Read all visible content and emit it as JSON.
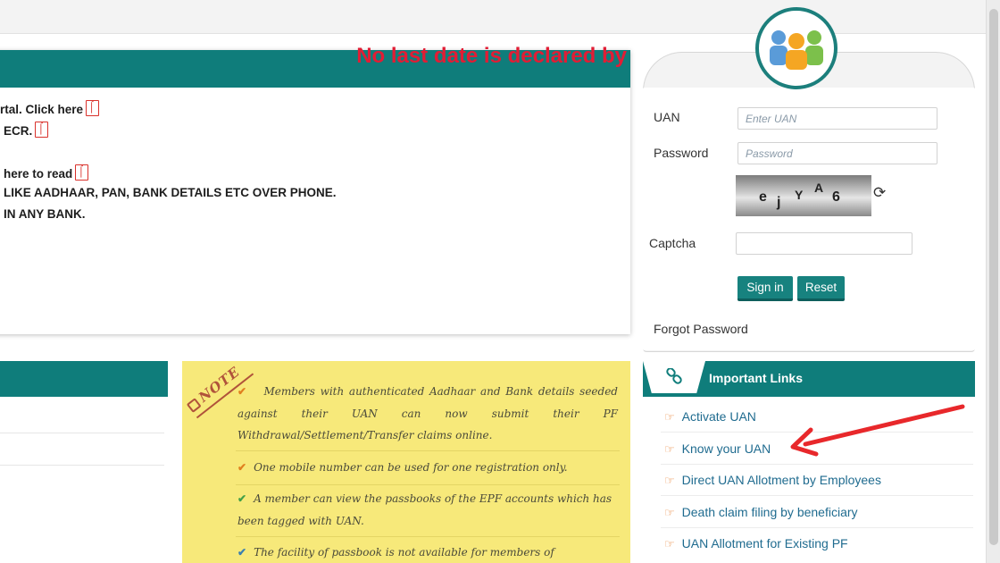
{
  "colors": {
    "teal": "#0f7d7b",
    "alert_red": "#e11d35",
    "note_yellow": "#f7e97a",
    "link_blue": "#1f6b8f",
    "arrow_red": "#e8282b"
  },
  "announcement": {
    "marquee": "No last date is declared by",
    "lines": [
      {
        "text": "rtal. Click here",
        "icon": "pdf-icon"
      },
      {
        "text": "ECR.",
        "icon": "pdf-icon"
      },
      {
        "text": "here to read",
        "icon": "pdf-icon"
      },
      {
        "text": "LIKE AADHAAR, PAN, BANK DETAILS ETC OVER PHONE.",
        "icon": ""
      },
      {
        "text": "IN ANY BANK.",
        "icon": ""
      }
    ]
  },
  "note": {
    "stamp": "NOTE",
    "items": [
      "Members with authenticated Aadhaar and Bank details seeded against their UAN can now submit their PF Withdrawal/Settlement/Transfer claims online.",
      "One mobile number can be used for one registration only.",
      "A member can view the passbooks of the EPF accounts which has been tagged with UAN.",
      "The facility of passbook is not available for members of establishments"
    ],
    "tick_colors": [
      "#e0801f",
      "#e0801f",
      "#43a047",
      "#3a7fb0"
    ]
  },
  "login": {
    "uan_label": "UAN",
    "uan_placeholder": "Enter UAN",
    "password_label": "Password",
    "password_placeholder": "Password",
    "captcha_label": "Captcha",
    "captcha_chars": [
      "e",
      "j",
      "Y",
      "A",
      "6"
    ],
    "signin_label": "Sign in",
    "reset_label": "Reset",
    "forgot_label": "Forgot Password",
    "refresh_icon": "refresh-icon"
  },
  "links": {
    "title": "Important Links",
    "icon": "link-icon",
    "items": [
      "Activate UAN",
      "Know your UAN",
      "Direct UAN Allotment by Employees",
      "Death claim filing by beneficiary",
      "UAN Allotment for Existing PF"
    ]
  }
}
